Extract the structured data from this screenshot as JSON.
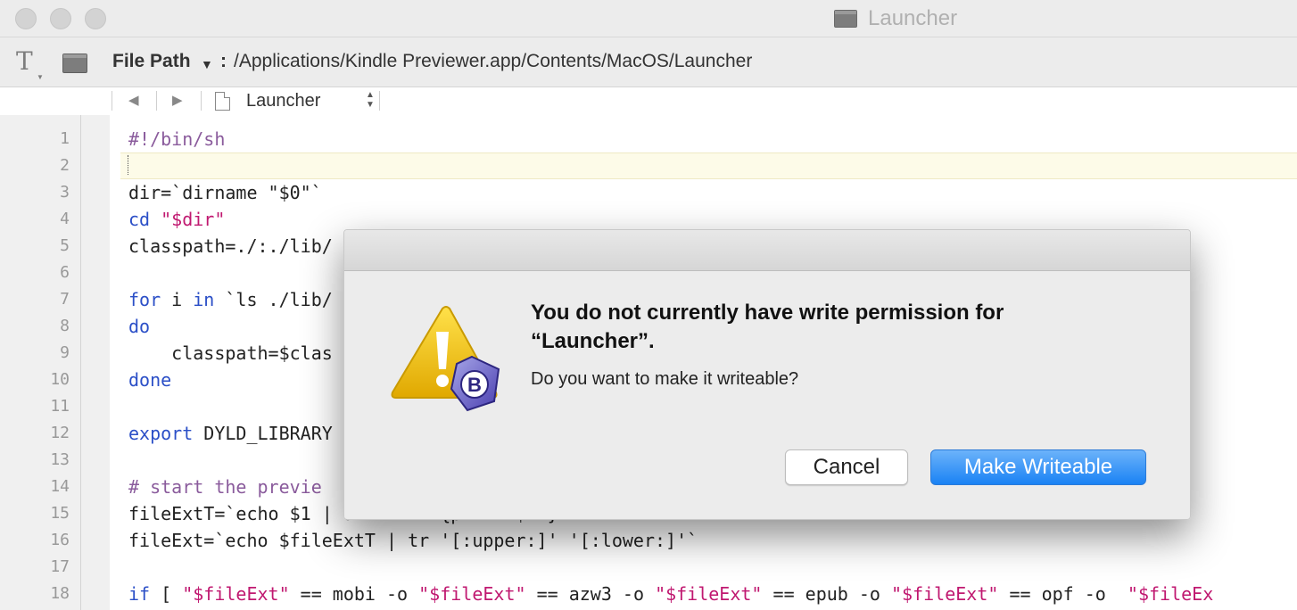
{
  "window": {
    "title": "Launcher"
  },
  "pathbar": {
    "label": "File Path",
    "separator": ":",
    "value": "/Applications/Kindle Previewer.app/Contents/MacOS/Launcher"
  },
  "navbar": {
    "back_glyph": "◀",
    "forward_glyph": "▶",
    "document_name": "Launcher",
    "popup_glyph": "▲▼"
  },
  "editor": {
    "line_numbers": [
      "1",
      "2",
      "3",
      "4",
      "5",
      "6",
      "7",
      "8",
      "9",
      "10",
      "11",
      "12",
      "13",
      "14",
      "15",
      "16",
      "17",
      "18"
    ],
    "current_line": 2
  },
  "code": {
    "l1": "#!/bin/sh",
    "l3": "dir=`dirname \"$0\"`",
    "l4_kw": "cd",
    "l4_str": "\"$dir\"",
    "l5": "classpath=./:./lib/",
    "l7_kw1": "for",
    "l7_a": " i ",
    "l7_kw2": "in",
    "l7_b": " `ls ./lib/",
    "l8_kw": "do",
    "l9": "    classpath=$clas",
    "l10_kw": "done",
    "l12_kw": "export",
    "l12_rest": " DYLD_LIBRARY",
    "l14_comment": "# start the previe",
    "l15": "fileExtT=`echo $1 | awk -F. '{print $NF}'`",
    "l16": "fileExt=`echo $fileExtT | tr '[:upper:]' '[:lower:]'`",
    "l18_kw": "if",
    "l18_t1": " [ ",
    "l18_s1": "\"$fileExt\"",
    "l18_t2": " == mobi -o ",
    "l18_s2": "\"$fileExt\"",
    "l18_t3": " == azw3 -o ",
    "l18_s3": "\"$fileExt\"",
    "l18_t4": " == epub -o ",
    "l18_s4": "\"$fileExt\"",
    "l18_t5": " == opf -o  ",
    "l18_s5": "\"$fileEx"
  },
  "dialog": {
    "title_line1": "You do not currently have write permission for",
    "title_line2": "“Launcher”.",
    "message": "Do you want to make it writeable?",
    "cancel_label": "Cancel",
    "primary_label": "Make Writeable"
  },
  "icons": {
    "warning": "warning-triangle-icon",
    "app_badge": "bbedit-icon",
    "text_tool": "text-tool-icon",
    "terminal": "terminal-icon",
    "document": "document-icon"
  },
  "colors": {
    "keyword": "#2b4fc7",
    "string": "#c01870",
    "comment": "#8a5b9c",
    "primary_button": "#1a82f4"
  }
}
